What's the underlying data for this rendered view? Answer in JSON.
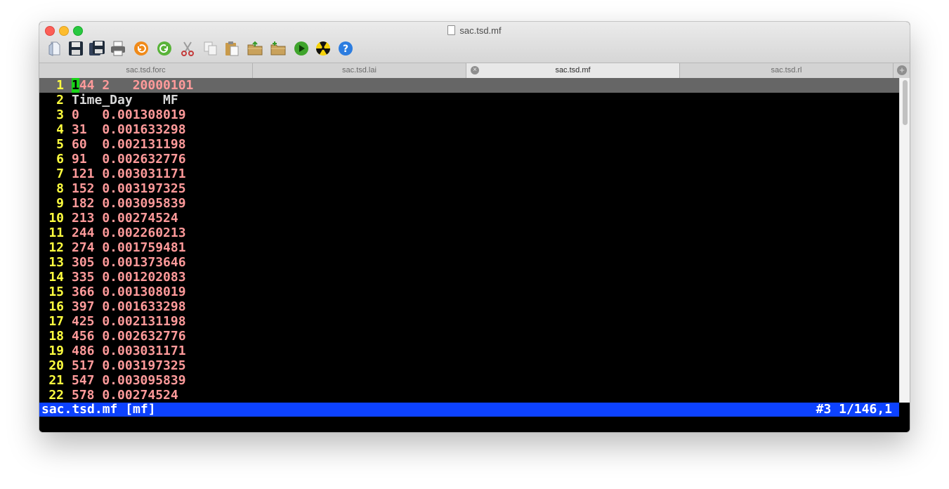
{
  "window": {
    "title": "sac.tsd.mf"
  },
  "toolbar": {
    "buttons": [
      {
        "name": "new-file-icon",
        "color": "#cfd8e6"
      },
      {
        "name": "save-icon",
        "color": "#1f2b3a"
      },
      {
        "name": "save-all-icon",
        "color": "#1f2b3a"
      },
      {
        "name": "print-icon",
        "color": "#5a5a5a"
      },
      {
        "name": "undo-icon",
        "color": "#f08a19"
      },
      {
        "name": "redo-icon",
        "color": "#58b338"
      },
      {
        "name": "cut-icon",
        "color": "#c43b3b"
      },
      {
        "name": "copy-icon",
        "color": "#c8c8c8"
      },
      {
        "name": "paste-icon",
        "color": "#c99a4a"
      },
      {
        "name": "open-folder-icon",
        "color": "#b48a4a"
      },
      {
        "name": "new-folder-icon",
        "color": "#b48a4a"
      },
      {
        "name": "run-icon",
        "color": "#3fa42c"
      },
      {
        "name": "radioactive-icon",
        "color": "#f5d20a"
      },
      {
        "name": "help-icon",
        "color": "#2c7de0"
      }
    ]
  },
  "tabs": [
    {
      "label": "sac.tsd.forc",
      "active": false
    },
    {
      "label": "sac.tsd.lai",
      "active": false
    },
    {
      "label": "sac.tsd.mf",
      "active": true
    },
    {
      "label": "sac.tsd.rl",
      "active": false
    }
  ],
  "editor": {
    "lines": [
      {
        "num": "1",
        "text": "144 2   20000101"
      },
      {
        "num": "2",
        "text": "Time_Day    MF"
      },
      {
        "num": "3",
        "text": "0   0.001308019"
      },
      {
        "num": "4",
        "text": "31  0.001633298"
      },
      {
        "num": "5",
        "text": "60  0.002131198"
      },
      {
        "num": "6",
        "text": "91  0.002632776"
      },
      {
        "num": "7",
        "text": "121 0.003031171"
      },
      {
        "num": "8",
        "text": "152 0.003197325"
      },
      {
        "num": "9",
        "text": "182 0.003095839"
      },
      {
        "num": "10",
        "text": "213 0.00274524"
      },
      {
        "num": "11",
        "text": "244 0.002260213"
      },
      {
        "num": "12",
        "text": "274 0.001759481"
      },
      {
        "num": "13",
        "text": "305 0.001373646"
      },
      {
        "num": "14",
        "text": "335 0.001202083"
      },
      {
        "num": "15",
        "text": "366 0.001308019"
      },
      {
        "num": "16",
        "text": "397 0.001633298"
      },
      {
        "num": "17",
        "text": "425 0.002131198"
      },
      {
        "num": "18",
        "text": "456 0.002632776"
      },
      {
        "num": "19",
        "text": "486 0.003031171"
      },
      {
        "num": "20",
        "text": "517 0.003197325"
      },
      {
        "num": "21",
        "text": "547 0.003095839"
      },
      {
        "num": "22",
        "text": "578 0.00274524"
      }
    ]
  },
  "status": {
    "left": "sac.tsd.mf [mf]",
    "right": "#3 1/146,1"
  },
  "colors": {
    "line_number": "#ffff3f",
    "text": "#ff9a9a",
    "cursor": "#19d319",
    "status_bar": "#0d42ff",
    "cursor_line": "#666666"
  }
}
